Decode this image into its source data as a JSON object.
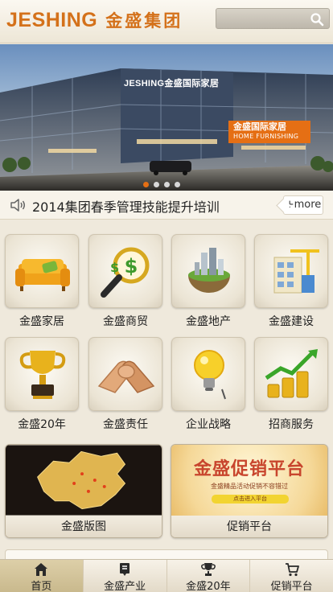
{
  "header": {
    "logo_latin": "JESHING",
    "logo_cjk": "金盛集团",
    "search_placeholder": "",
    "search_icon": "search-icon"
  },
  "banner": {
    "building_sign": "JESHING金盛国际家居",
    "tag_cn": "金盛国际家居",
    "tag_en": "HOME FURNISHING",
    "active_slide": 1,
    "slide_count": 4
  },
  "news": {
    "icon": "speaker-icon",
    "headline": "2014集团春季管理技能提升培训",
    "more_label": "+more"
  },
  "tiles": [
    {
      "label": "金盛家居",
      "icon": "sofa-icon"
    },
    {
      "label": "金盛商贸",
      "icon": "magnifier-dollar-icon"
    },
    {
      "label": "金盛地产",
      "icon": "buildings-globe-icon"
    },
    {
      "label": "金盛建设",
      "icon": "construction-building-icon"
    },
    {
      "label": "金盛20年",
      "icon": "trophy-icon"
    },
    {
      "label": "金盛责任",
      "icon": "handshake-icon"
    },
    {
      "label": "企业战略",
      "icon": "lightbulb-icon"
    },
    {
      "label": "招商服务",
      "icon": "coins-growth-icon"
    }
  ],
  "cards": [
    {
      "label": "金盛版图",
      "icon": "china-map-icon"
    },
    {
      "label": "促销平台",
      "title": "金盛促销平台",
      "subtitle": "金盛精品活动促销不容错过",
      "button": "点击进入平台"
    }
  ],
  "bottom_nav": [
    {
      "label": "首页",
      "icon": "home-icon",
      "active": true
    },
    {
      "label": "金盛产业",
      "icon": "document-icon",
      "active": false
    },
    {
      "label": "金盛20年",
      "icon": "trophy-icon",
      "active": false
    },
    {
      "label": "促销平台",
      "icon": "cart-icon",
      "active": false
    }
  ],
  "colors": {
    "accent": "#d4711a",
    "tag_orange": "#e56f14",
    "promo_red": "#c8452d",
    "background": "#efe9dc"
  }
}
